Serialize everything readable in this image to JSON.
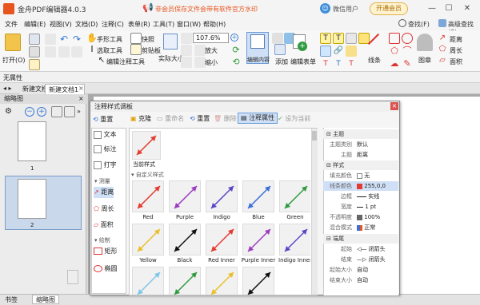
{
  "app": {
    "title": "金舟PDF编辑器4.0.3",
    "notice": "非会员保存文件会带有软件官方水印",
    "user": "微信用户",
    "vip_button": "开通会员",
    "window_controls": [
      "—",
      "☐",
      "✕"
    ],
    "accent": "#e8541e"
  },
  "menu": [
    "文件",
    "编辑(E)",
    "视图(V)",
    "文档(D)",
    "注释(C)",
    "表单(R)",
    "工具(T)",
    "窗口(W)",
    "帮助(H)"
  ],
  "menu_right": {
    "search": "查找(F)",
    "advanced_search": "高级查找(S)"
  },
  "ribbon": {
    "open": "打开(O)",
    "hand_tool": "手形工具",
    "select_text": "选取工具",
    "edit_annot_tool": "编辑注释工具",
    "snapshot": "快照",
    "clipboard": "剪贴板",
    "actual_size": "实际大小",
    "zoom_value": "107.6%",
    "zoom_in": "放大",
    "zoom_out": "缩小",
    "edit_content": "编辑内容",
    "add": "添加",
    "edit_form": "编辑表单",
    "line": "线条",
    "stamp": "图章",
    "distance": "距离",
    "perimeter": "周长",
    "area": "面积"
  },
  "property_bar": "无属性",
  "tabs": [
    "新建文档",
    "新建文档1"
  ],
  "thumb_panel": {
    "title": "缩略图",
    "pages": [
      "1",
      "2"
    ]
  },
  "bottom_tabs": [
    "书签",
    "缩略图"
  ],
  "dialog": {
    "title": "注释样式调板",
    "left_toolbar_reset": "重置",
    "left_tools": [
      "文本",
      "标注",
      "打字"
    ],
    "sections": {
      "measure": "测量",
      "draw": "绘制"
    },
    "measure_tools": [
      "距离",
      "周长",
      "面积"
    ],
    "draw_tools": [
      "矩形",
      "椭圆"
    ],
    "toolbar": [
      "克隆",
      "重命名",
      "重置",
      "删除",
      "注释属性",
      "设为当前"
    ],
    "current_style": "当前样式",
    "custom_styles": "自定义样式",
    "styles": [
      "Red",
      "Purple",
      "Indigo",
      "Blue",
      "Green",
      "Yellow",
      "Black",
      "Red Inner",
      "Purple Inner",
      "Indigo Inner"
    ],
    "style_colors": [
      "#e23b30",
      "#9c3bc0",
      "#5a46c8",
      "#3c6ed8",
      "#2f9a3f",
      "#e9c02a",
      "#111111",
      "#e23b30",
      "#9c3bc0",
      "#5a46c8",
      "#7fc6e8",
      "#2f9a3f",
      "#e9c02a",
      "#111111"
    ]
  },
  "props": {
    "section_subject": "主题",
    "subject_type_key": "主题类别",
    "subject_type_val": "默认",
    "subject_key": "主题",
    "subject_val": "距离",
    "section_style": "样式",
    "fill_color_key": "填充颜色",
    "fill_color_val": "无",
    "line_color_key": "线条颜色",
    "line_color_val": "255,0,0",
    "border_key": "边框",
    "border_val": "实线",
    "width_key": "宽度",
    "width_val": "1 pt",
    "opacity_key": "不透明度",
    "opacity_val": "100%",
    "blend_key": "混合模式",
    "blend_val": "正常",
    "section_ends": "端尾",
    "start_key": "起始",
    "start_val": "闭箭头",
    "end_key": "结束",
    "end_val": "闭箭头",
    "start_size_key": "起始大小",
    "start_size_val": "自动",
    "end_size_key": "结束大小",
    "end_size_val": "自动"
  }
}
